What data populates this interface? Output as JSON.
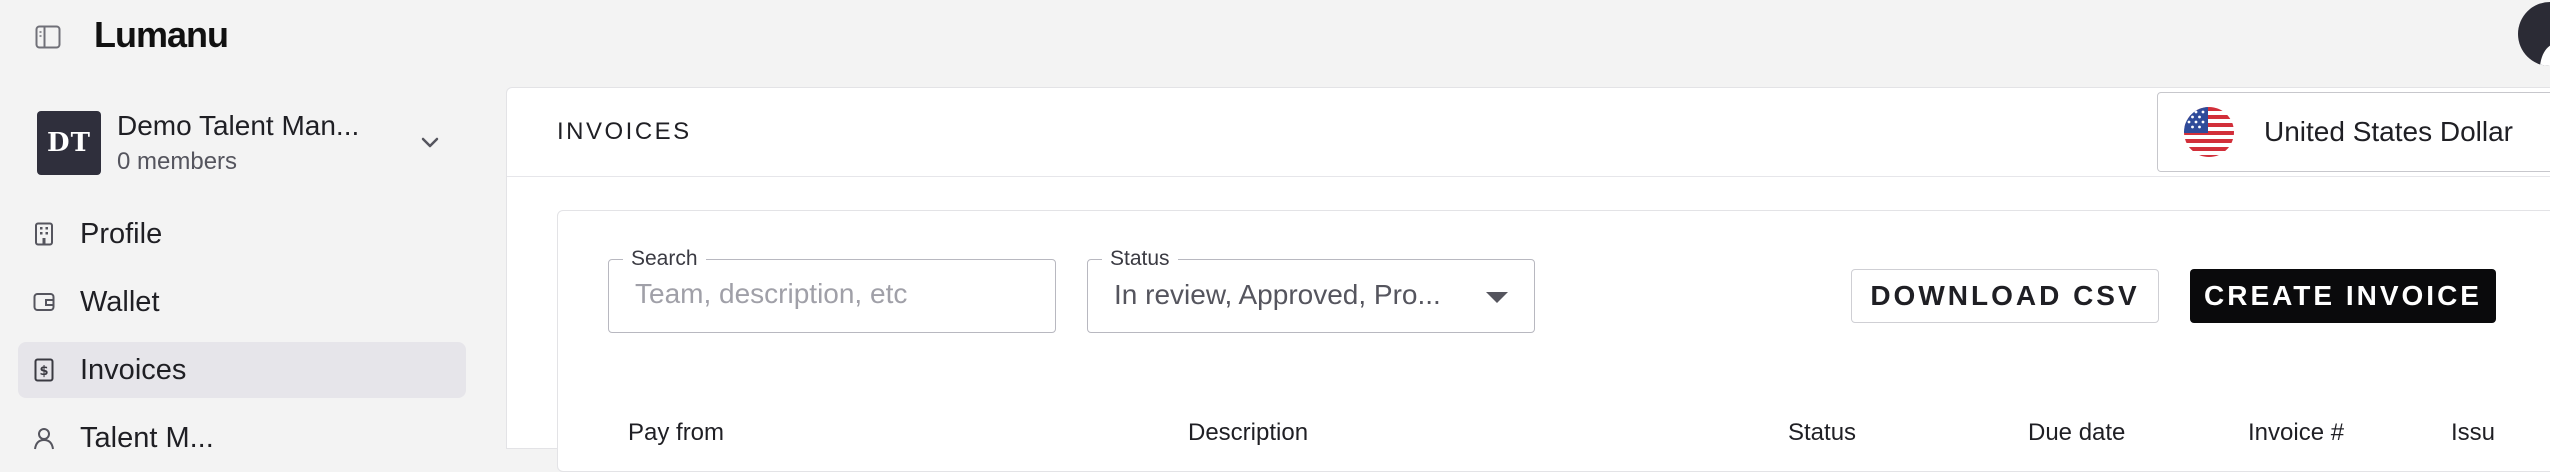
{
  "app": {
    "logo": "Lumanu"
  },
  "icons": {
    "sidebar_toggle": "sidebar-toggle-icon",
    "user_avatar": "user-icon",
    "org_chevron": "chevron-down-icon",
    "flag": "us-flag-icon",
    "status_caret": "caret-down-icon"
  },
  "org": {
    "initials": "DT",
    "name": "Demo Talent Man...",
    "members": "0 members"
  },
  "sidebar": {
    "items": [
      {
        "label": "Profile",
        "icon": "building-icon",
        "active": false
      },
      {
        "label": "Wallet",
        "icon": "wallet-icon",
        "active": false
      },
      {
        "label": "Invoices",
        "icon": "invoice-dollar-icon",
        "active": true
      },
      {
        "label": "Talent M...",
        "icon": "talent-icon",
        "active": false
      }
    ]
  },
  "main": {
    "title": "INVOICES",
    "currency": {
      "label": "United States Dollar",
      "flag": "us-flag-icon"
    },
    "filters": {
      "search": {
        "legend": "Search",
        "placeholder": "Team, description, etc",
        "value": ""
      },
      "status": {
        "legend": "Status",
        "value": "In review, Approved, Pro..."
      }
    },
    "actions": {
      "download_label": "DOWNLOAD CSV",
      "create_label": "CREATE INVOICE"
    },
    "table": {
      "columns": [
        "Pay from",
        "Description",
        "Status",
        "Due date",
        "Invoice #",
        "Issu"
      ]
    }
  },
  "colors": {
    "accent": "#0a0a0c",
    "active_nav_bg": "#e6e5ea",
    "org_avatar_bg": "#2f2f3c"
  }
}
